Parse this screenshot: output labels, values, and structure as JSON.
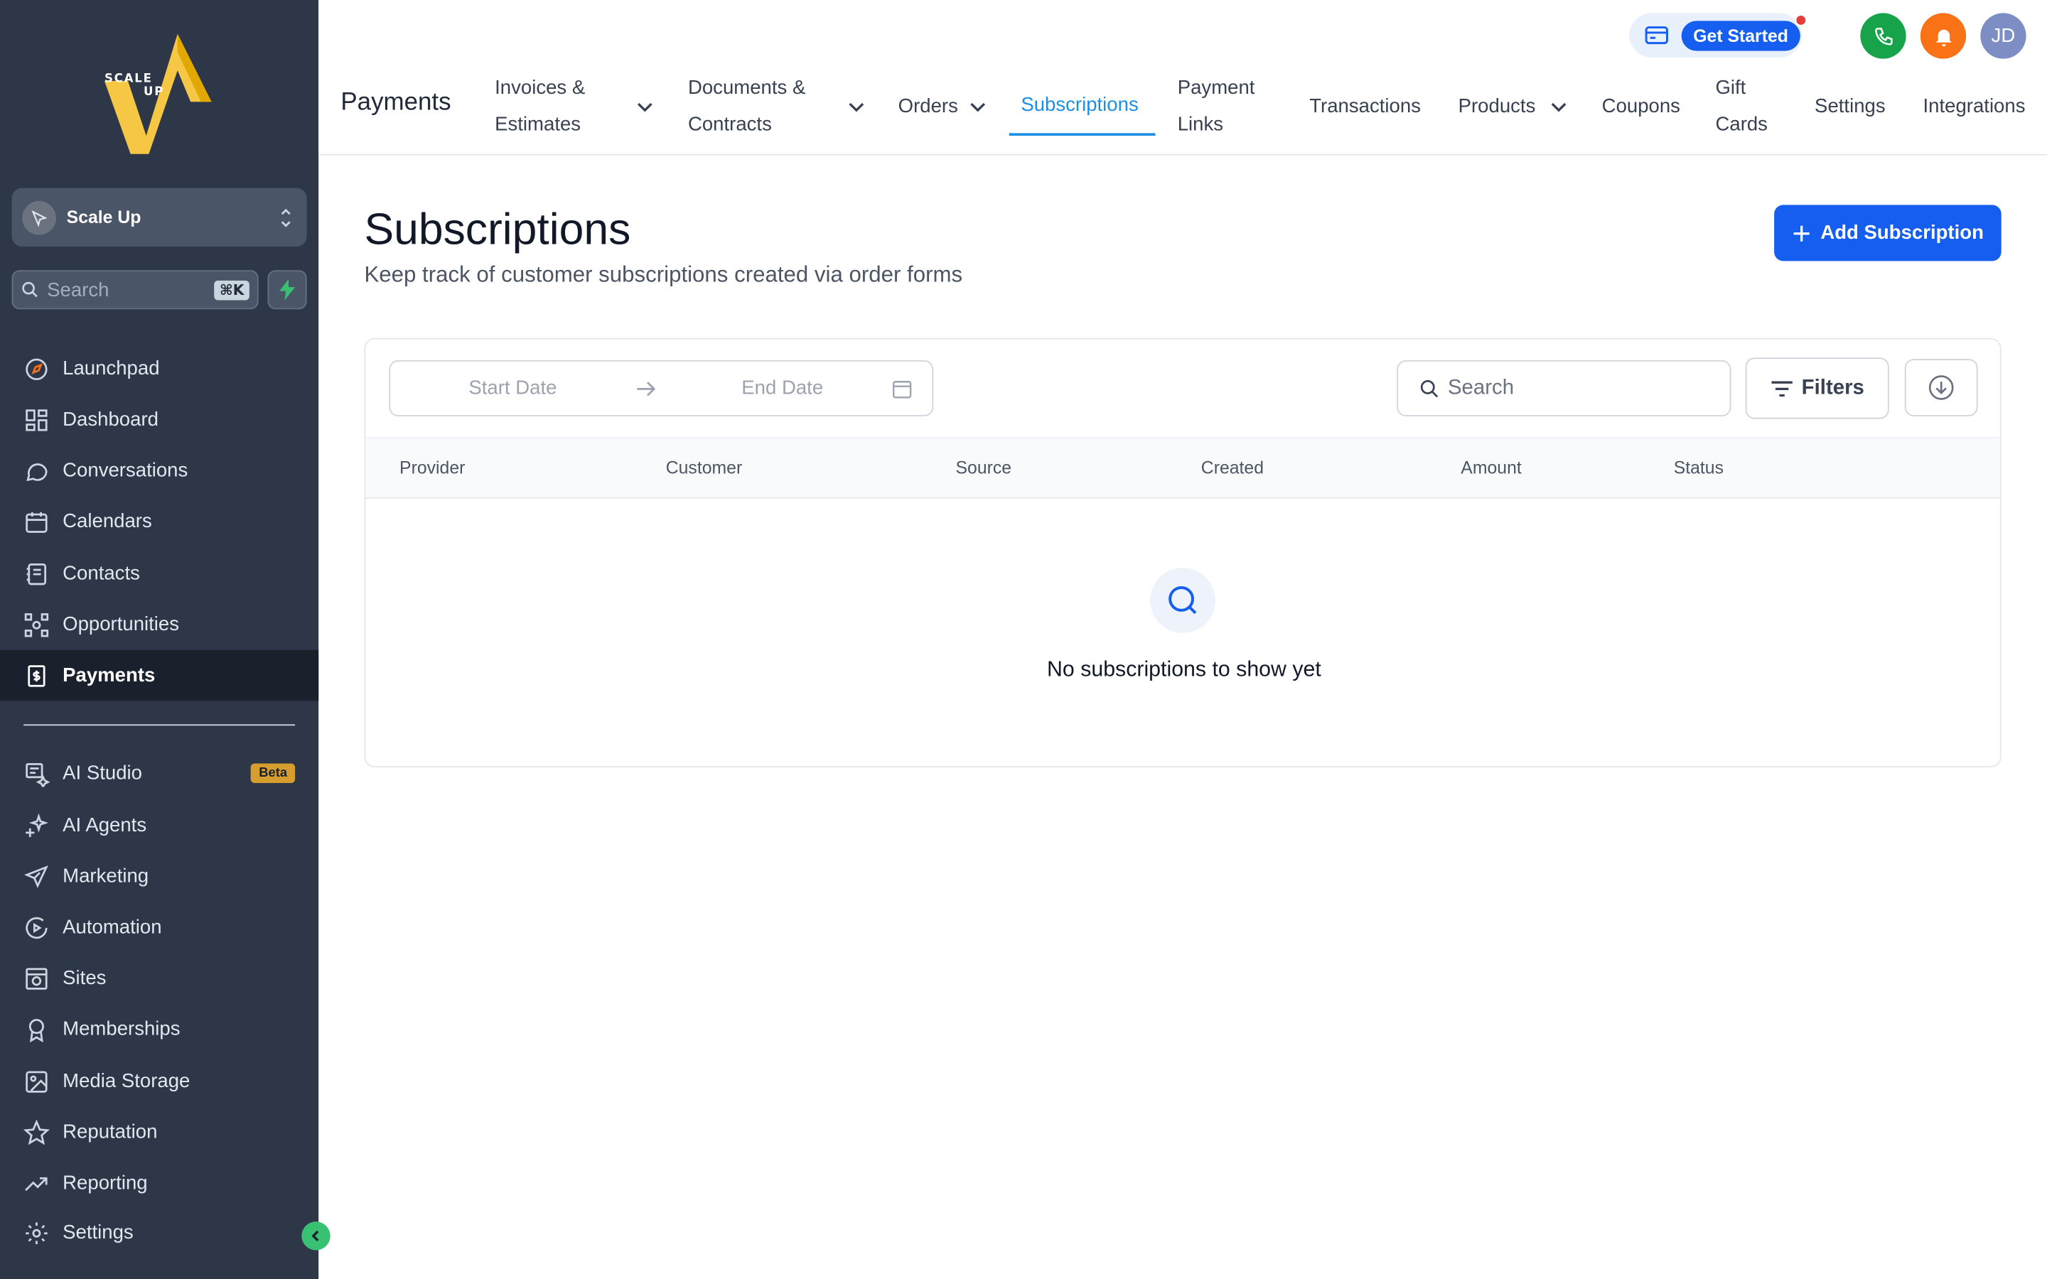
{
  "sidebar": {
    "logo_text_top": "SCALE",
    "logo_text_bottom": "UP",
    "account_name": "Scale Up",
    "search_placeholder": "Search",
    "search_shortcut": "⌘K",
    "nav_main": [
      {
        "label": "Launchpad",
        "icon": "rocket-icon"
      },
      {
        "label": "Dashboard",
        "icon": "dashboard-icon"
      },
      {
        "label": "Conversations",
        "icon": "chat-icon"
      },
      {
        "label": "Calendars",
        "icon": "calendar-icon"
      },
      {
        "label": "Contacts",
        "icon": "contacts-icon"
      },
      {
        "label": "Opportunities",
        "icon": "opportunities-icon"
      },
      {
        "label": "Payments",
        "icon": "payments-icon",
        "active": true
      }
    ],
    "nav_secondary": [
      {
        "label": "AI Studio",
        "icon": "ai-studio-icon",
        "badge": "Beta"
      },
      {
        "label": "AI Agents",
        "icon": "sparkle-icon"
      },
      {
        "label": "Marketing",
        "icon": "send-icon"
      },
      {
        "label": "Automation",
        "icon": "automation-icon"
      },
      {
        "label": "Sites",
        "icon": "sites-icon"
      },
      {
        "label": "Memberships",
        "icon": "badge-icon"
      },
      {
        "label": "Media Storage",
        "icon": "image-icon"
      },
      {
        "label": "Reputation",
        "icon": "star-icon"
      },
      {
        "label": "Reporting",
        "icon": "trend-icon"
      },
      {
        "label": "Settings",
        "icon": "gear-icon"
      }
    ]
  },
  "topbar": {
    "get_started": "Get Started",
    "avatar_initials": "JD",
    "section_title": "Payments",
    "tabs": {
      "invoices_1": "Invoices &",
      "invoices_2": "Estimates",
      "documents_1": "Documents &",
      "documents_2": "Contracts",
      "orders": "Orders",
      "subscriptions": "Subscriptions",
      "payment_links_1": "Payment",
      "payment_links_2": "Links",
      "transactions": "Transactions",
      "products": "Products",
      "coupons": "Coupons",
      "gift_cards_1": "Gift",
      "gift_cards_2": "Cards",
      "settings": "Settings",
      "integrations": "Integrations"
    },
    "active_tab": "Subscriptions"
  },
  "main": {
    "title": "Subscriptions",
    "subtitle": "Keep track of customer subscriptions created via order forms",
    "add_button": "Add Subscription",
    "start_date_placeholder": "Start Date",
    "end_date_placeholder": "End Date",
    "search_placeholder": "Search",
    "filters_label": "Filters",
    "columns": [
      "Provider",
      "Customer",
      "Source",
      "Created",
      "Amount",
      "Status"
    ],
    "empty_message": "No subscriptions to show yet"
  },
  "colors": {
    "sidebar_bg": "#2d3748",
    "primary": "#155eef",
    "active_tab": "#1d8fe1"
  }
}
